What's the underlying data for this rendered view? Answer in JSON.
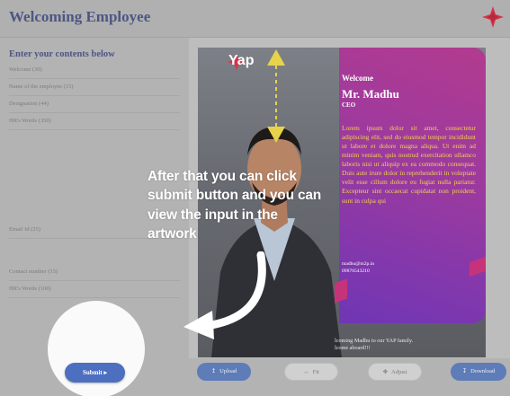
{
  "header": {
    "title": "Welcoming Employee",
    "logo": "red-cross-logo"
  },
  "form": {
    "title": "Enter your contents below",
    "fields": [
      {
        "label": "Welcome (30)"
      },
      {
        "label": "Name of the employee (15)"
      },
      {
        "label": "Designation (44)"
      },
      {
        "label": "HR's Words (350)"
      },
      {
        "label": "Email Id (25)"
      },
      {
        "label": "Contact number (15)"
      },
      {
        "label": "HR's Words (100)"
      }
    ],
    "submit_label": "Submit"
  },
  "artwork": {
    "brand_text": "Yap",
    "welcome": "Welcome",
    "name": "Mr. Madhu",
    "designation": "CEO",
    "bio": "Lorem ipsum dolor sit amet, consectetur adipiscing elit, sed do eiusmod tempor incididunt ut labore et dolore magna aliqua. Ut enim ad minim veniam, quis nostrud exercitation ullamco laboris nisi ut aliquip ex ea commodo consequat. Duis aute irure dolor in reprehenderit in voluptate velit esse cillum dolore eu fugiat nulla pariatur. Excepteur sint occaecat cupidatat non proident, sunt in culpa qui",
    "email": "madhu@m2p.in",
    "phone": "09876543210",
    "footer_line1": "lcoming Madhu to our YAP family.",
    "footer_line2": "lcome aboard!!!"
  },
  "instruction": {
    "text": "After that you can click submit button and you can view the input in the artwork"
  },
  "toolbar": {
    "upload_label": "Upload",
    "fit_label": "Fit",
    "adjust_label": "Adjust",
    "download_label": "Download"
  },
  "colors": {
    "accent": "#4d6fc0",
    "title": "#4d5683",
    "card_pink": "#b23b8f",
    "card_purple": "#6f36b5",
    "bio_text": "#f3d54a",
    "logo_red": "#d6344a"
  }
}
